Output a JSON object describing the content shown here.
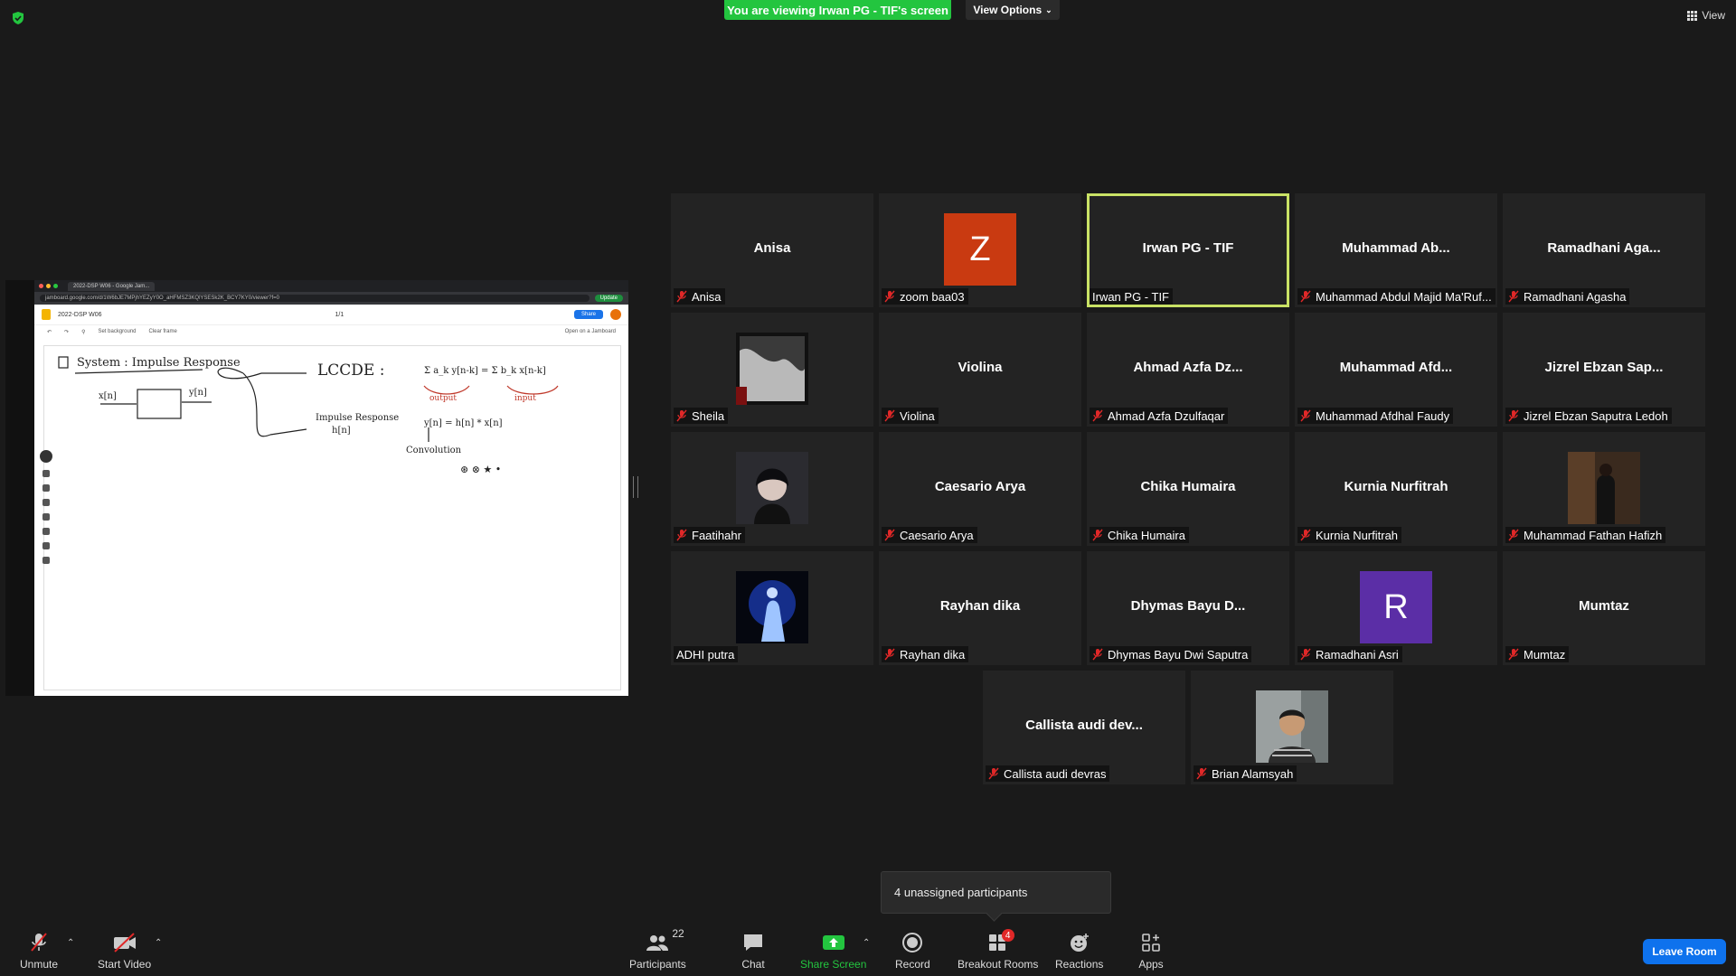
{
  "banner": {
    "viewing_text": "You are viewing Irwan PG - TIF's screen",
    "view_options_label": "View Options",
    "view_label": "View"
  },
  "shared_screen": {
    "tab_title": "2022-DSP W06 - Google Jam...",
    "url": "jamboard.google.com/d/1W6bJE7MPjhYEZyY0O_aHFMSZ3KQlYSESk2K_BCY7KY0/viewer?f=0",
    "update_label": "Update",
    "doc_title": "2022-DSP W06",
    "share_label": "Share",
    "set_background_label": "Set background",
    "clear_frame_label": "Clear frame",
    "open_jamboard_label": "Open on a Jamboard",
    "frame_indicator": "1/1",
    "board": {
      "system_title": "System : Impulse Response",
      "input_label": "x[n]",
      "output_label": "y[n]",
      "lccde_label": "LCCDE :",
      "impulse_label_1": "Impulse Response",
      "impulse_label_2": "h[n]",
      "equation": "Σ a_k y[n-k] = Σ b_k x[n-k]",
      "output_note": "output",
      "input_note": "input",
      "convolution_eq": "y[n] = h[n] * x[n]",
      "convolution_label": "Convolution",
      "symbols": "⊛  ⊗  ★  •"
    }
  },
  "participants": [
    {
      "display": "Anisa",
      "label": "Anisa",
      "muted": true,
      "type": "name"
    },
    {
      "display": "Z",
      "label": "zoom baa03",
      "muted": true,
      "type": "letter",
      "color": "#c93a11"
    },
    {
      "display": "Irwan PG - TIF",
      "label": "Irwan PG - TIF",
      "muted": false,
      "type": "name",
      "active": true
    },
    {
      "display": "Muhammad  Ab...",
      "label": "Muhammad Abdul Majid Ma'Ruf...",
      "muted": true,
      "type": "name"
    },
    {
      "display": "Ramadhani  Aga...",
      "label": "Ramadhani Agasha",
      "muted": true,
      "type": "name"
    },
    {
      "display": "",
      "label": "Sheila",
      "muted": true,
      "type": "photo",
      "photo": "sheila"
    },
    {
      "display": "Violina",
      "label": "Violina",
      "muted": true,
      "type": "name"
    },
    {
      "display": "Ahmad  Azfa  Dz...",
      "label": "Ahmad Azfa Dzulfaqar",
      "muted": true,
      "type": "name"
    },
    {
      "display": "Muhammad  Afd...",
      "label": "Muhammad Afdhal Faudy",
      "muted": true,
      "type": "name"
    },
    {
      "display": "Jizrel  Ebzan  Sap...",
      "label": "Jizrel Ebzan Saputra Ledoh",
      "muted": true,
      "type": "name"
    },
    {
      "display": "",
      "label": "Faatihahr",
      "muted": true,
      "type": "photo",
      "photo": "faatihahr"
    },
    {
      "display": "Caesario Arya",
      "label": "Caesario Arya",
      "muted": true,
      "type": "name"
    },
    {
      "display": "Chika Humaira",
      "label": "Chika Humaira",
      "muted": true,
      "type": "name"
    },
    {
      "display": "Kurnia Nurfitrah",
      "label": "Kurnia Nurfitrah",
      "muted": true,
      "type": "name"
    },
    {
      "display": "",
      "label": "Muhammad Fathan Hafizh",
      "muted": true,
      "type": "photo",
      "photo": "fathan"
    },
    {
      "display": "",
      "label": "ADHI putra",
      "muted": false,
      "type": "photo",
      "photo": "adhi"
    },
    {
      "display": "Rayhan dika",
      "label": "Rayhan dika",
      "muted": true,
      "type": "name"
    },
    {
      "display": "Dhymas  Bayu  D...",
      "label": "Dhymas Bayu Dwi Saputra",
      "muted": true,
      "type": "name"
    },
    {
      "display": "R",
      "label": "Ramadhani Asri",
      "muted": true,
      "type": "letter",
      "color": "#5b2ea6"
    },
    {
      "display": "Mumtaz",
      "label": "Mumtaz",
      "muted": true,
      "type": "name"
    },
    {
      "display": "Callista  audi  dev...",
      "label": "Callista audi devras",
      "muted": true,
      "type": "name"
    },
    {
      "display": "",
      "label": "Brian Alamsyah",
      "muted": true,
      "type": "photo",
      "photo": "brian"
    }
  ],
  "unassigned_popup": "4 unassigned participants",
  "toolbar": {
    "unmute": "Unmute",
    "start_video": "Start Video",
    "participants": "Participants",
    "participants_count": "22",
    "chat": "Chat",
    "share_screen": "Share Screen",
    "record": "Record",
    "breakout_rooms": "Breakout Rooms",
    "breakout_badge": "4",
    "reactions": "Reactions",
    "apps": "Apps",
    "leave_room": "Leave Room"
  },
  "colors": {
    "banner_green": "#23c53f",
    "active_speaker_outline": "#c9e265",
    "leave_blue": "#0e72ed",
    "muted_red": "#e02828"
  }
}
